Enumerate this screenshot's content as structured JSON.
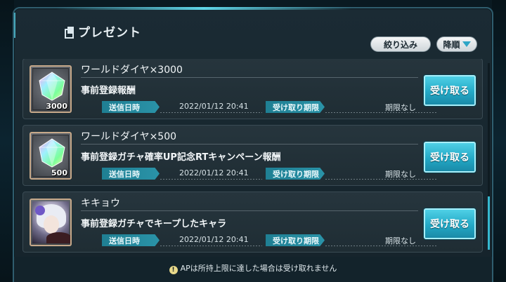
{
  "header": {
    "title": "プレゼント",
    "filter_label": "絞り込み",
    "sort_label": "降順"
  },
  "presents": [
    {
      "name": "ワールドダイヤ×3000",
      "description": "事前登録報酬",
      "quantity": "3000",
      "sent_label": "送信日時",
      "sent_date": "2022/01/12 20:41",
      "limit_label": "受け取り期限",
      "limit_value": "期限なし",
      "receive_label": "受け取る",
      "icon": "diamond-icon"
    },
    {
      "name": "ワールドダイヤ×500",
      "description": "事前登録ガチャ確率UP記念RTキャンペーン報酬",
      "quantity": "500",
      "sent_label": "送信日時",
      "sent_date": "2022/01/12 20:41",
      "limit_label": "受け取り期限",
      "limit_value": "期限なし",
      "receive_label": "受け取る",
      "icon": "diamond-icon"
    },
    {
      "name": "キキョウ",
      "description": "事前登録ガチャでキープしたキャラ",
      "quantity": "",
      "sent_label": "送信日時",
      "sent_date": "2022/01/12 20:41",
      "limit_label": "受け取り期限",
      "limit_value": "期限なし",
      "receive_label": "受け取る",
      "icon": "character-portrait"
    }
  ],
  "footer": {
    "notice_icon": "!",
    "notice": "APは所持上限に達した場合は受け取れません"
  },
  "colors": {
    "accent": "#2fa6c6",
    "receive_button": "#23a9c6",
    "tag": "#1f7f93",
    "frame": "#2f5d6e"
  }
}
